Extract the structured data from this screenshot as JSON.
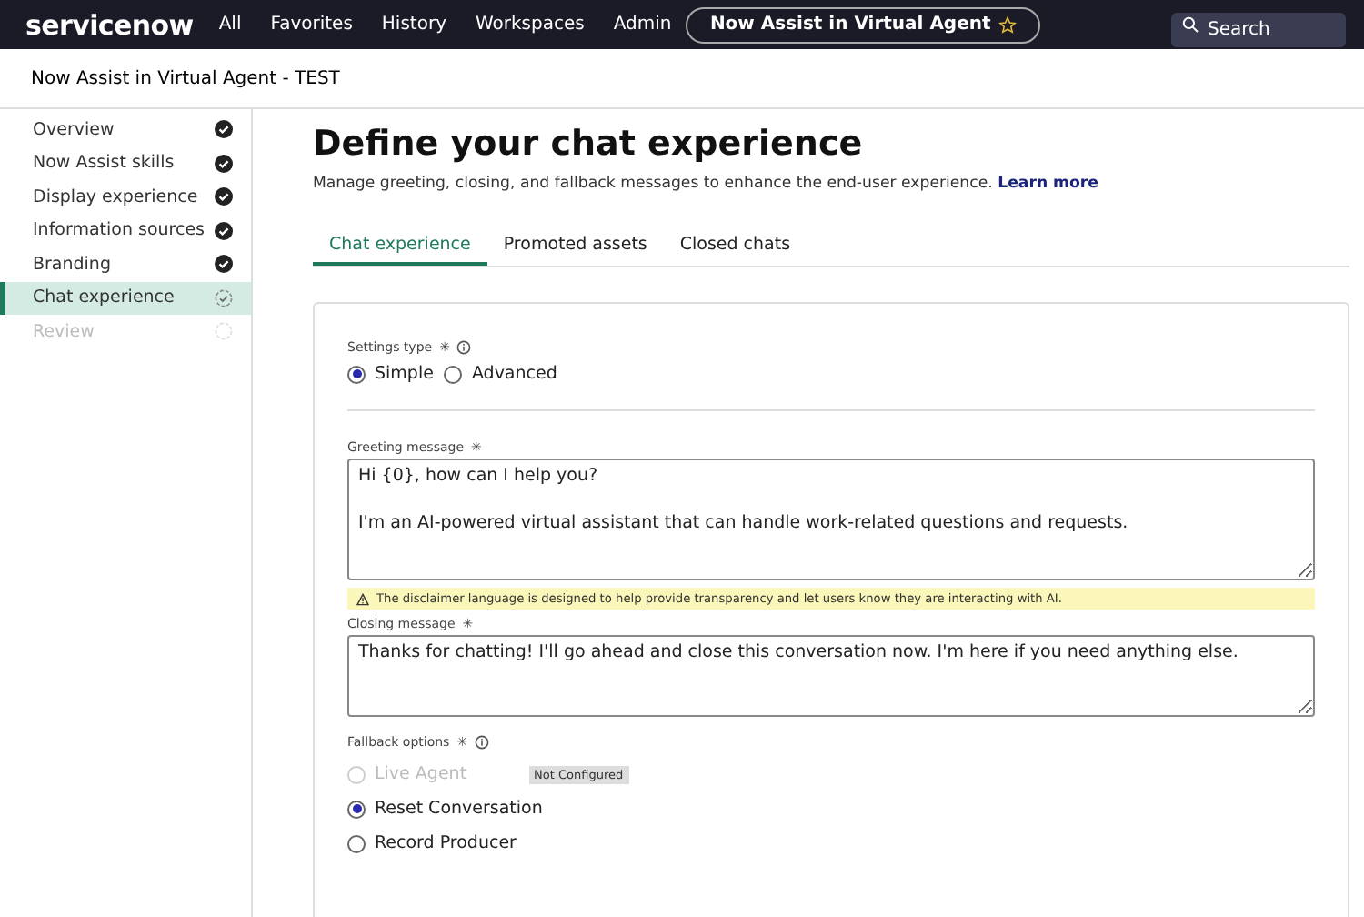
{
  "header": {
    "logo": "servicenow",
    "nav": [
      "All",
      "Favorites",
      "History",
      "Workspaces",
      "Admin"
    ],
    "context": "Now Assist in Virtual Agent",
    "favorite": false,
    "search": {
      "placeholder": "Search"
    }
  },
  "subheader": {
    "title": "Now Assist in Virtual Agent - TEST"
  },
  "sidebar": {
    "items": [
      {
        "label": "Overview",
        "kind": "done",
        "selected": false
      },
      {
        "label": "Now Assist skills",
        "kind": "done",
        "selected": false
      },
      {
        "label": "Display experience",
        "kind": "done",
        "selected": false
      },
      {
        "label": "Information sources",
        "kind": "done",
        "selected": false
      },
      {
        "label": "Branding",
        "kind": "done",
        "selected": false
      },
      {
        "label": "Chat experience",
        "kind": "current",
        "selected": true
      },
      {
        "label": "Review",
        "kind": "pending",
        "selected": false,
        "disabled": true
      }
    ]
  },
  "main": {
    "title": "Define your chat experience",
    "description": "Manage greeting, closing, and fallback messages to enhance the end-user experience.",
    "link": "Learn more",
    "tabs": [
      {
        "label": "Chat experience",
        "selected": true
      },
      {
        "label": "Promoted assets",
        "selected": false
      },
      {
        "label": "Closed chats",
        "selected": false
      }
    ],
    "settings_type": {
      "label": "Settings type",
      "required": "✳",
      "options": [
        {
          "label": "Simple",
          "selected": true
        },
        {
          "label": "Advanced",
          "selected": false
        }
      ]
    },
    "greeting": {
      "label": "Greeting message",
      "required": "✳",
      "value": "Hi {0}, how can I help you?\n\nI'm an AI-powered virtual assistant that can handle work-related questions and requests."
    },
    "warning": "The disclaimer language is designed to help provide transparency and let users know they are interacting with AI.",
    "closing": {
      "label": "Closing message",
      "required": "✳",
      "value": "Thanks for chatting! I'll go ahead and close this conversation now. I'm here if you need anything else."
    },
    "fallback": {
      "label": "Fallback options",
      "required": "✳",
      "options": [
        {
          "label": "Live Agent",
          "selected": false,
          "disabled": true,
          "badge": "Not Configured"
        },
        {
          "label": "Reset Conversation",
          "selected": true,
          "disabled": false
        },
        {
          "label": "Record Producer",
          "selected": false,
          "disabled": false
        }
      ]
    }
  }
}
